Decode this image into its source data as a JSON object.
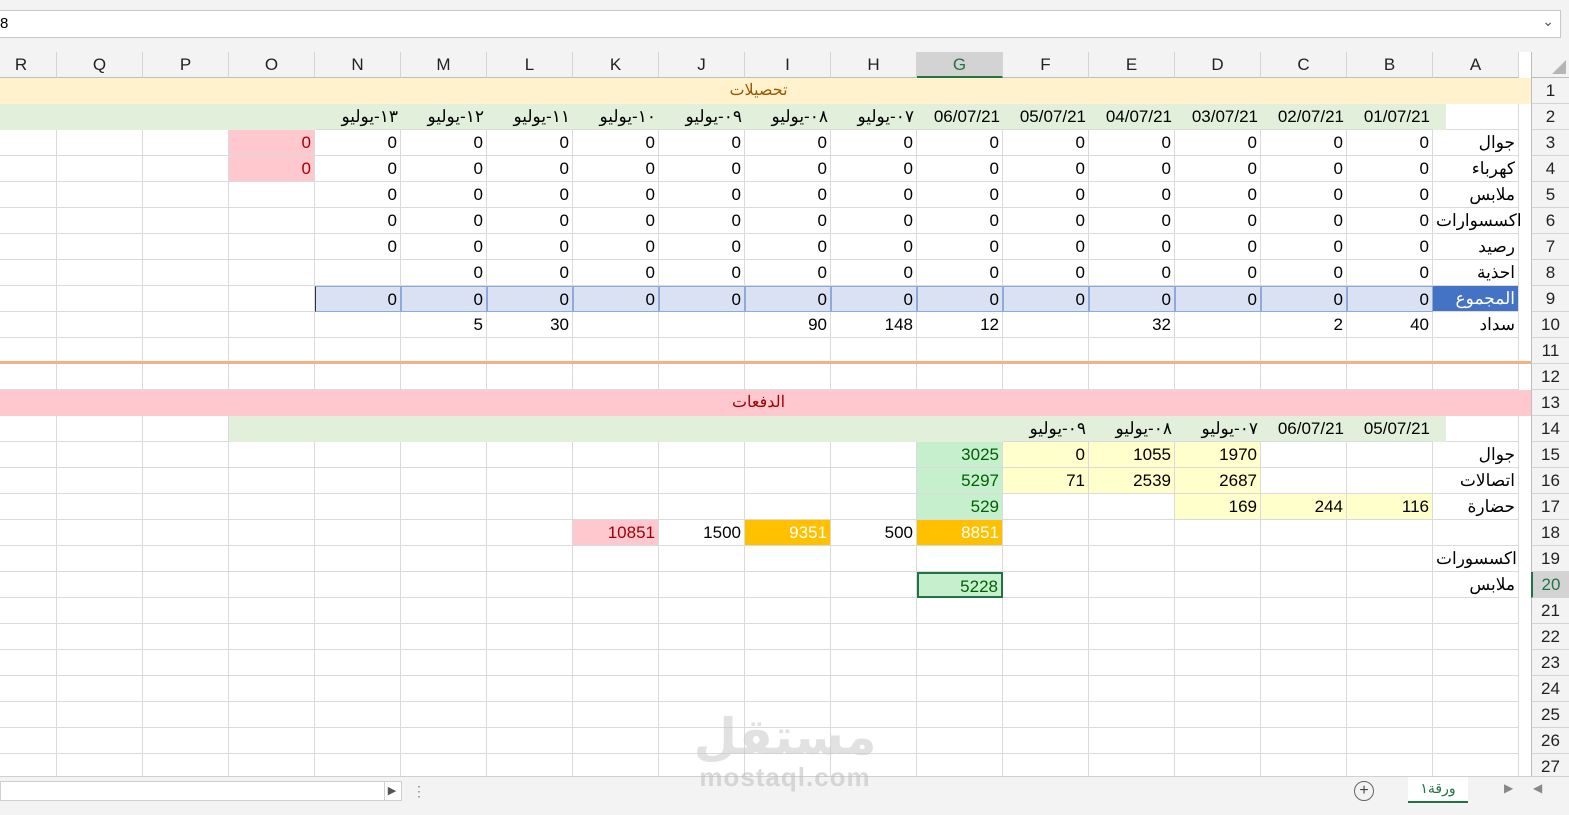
{
  "formula_bar": {
    "value": "8"
  },
  "columns": [
    "R",
    "Q",
    "P",
    "O",
    "N",
    "M",
    "L",
    "K",
    "J",
    "I",
    "H",
    "G",
    "F",
    "E",
    "D",
    "C",
    "B",
    "A"
  ],
  "selected_column": "G",
  "selected_row": 20,
  "rows": [
    1,
    2,
    3,
    4,
    5,
    6,
    7,
    8,
    9,
    10,
    11,
    12,
    13,
    14,
    15,
    16,
    17,
    18,
    19,
    20,
    21,
    22,
    23,
    24,
    25,
    26,
    27
  ],
  "section1": {
    "title": "تحصيلات",
    "dates": {
      "B": "01/07/21",
      "C": "02/07/21",
      "D": "03/07/21",
      "E": "04/07/21",
      "F": "05/07/21",
      "G": "06/07/21",
      "H": "٠٧-يوليو",
      "I": "٠٨-يوليو",
      "J": "٠٩-يوليو",
      "K": "١٠-يوليو",
      "L": "١١-يوليو",
      "M": "١٢-يوليو",
      "N": "١٣-يوليو"
    },
    "row_labels": {
      "3": "جوال",
      "4": "كهرباء",
      "5": "ملابس",
      "6": "اكسسوارات",
      "7": "رصيد",
      "8": "احذية",
      "9": "المجموع",
      "10": "سداد"
    },
    "zero_value": "0",
    "o_cells": {
      "3": "0",
      "4": "0"
    },
    "payments_row": {
      "B": "40",
      "C": "2",
      "E": "32",
      "G": "12",
      "H": "148",
      "I": "90",
      "L": "30",
      "M": "5"
    }
  },
  "section2": {
    "title": "الدفعات",
    "dates": {
      "B": "05/07/21",
      "C": "06/07/21",
      "D": "٠٧-يوليو",
      "E": "٠٨-يوليو",
      "F": "٠٩-يوليو"
    },
    "row_labels": {
      "15": "جوال",
      "16": "اتصالات",
      "17": "حضارة",
      "19": "اكسسورات",
      "20": "ملابس"
    },
    "values": {
      "15": {
        "D": "1970",
        "E": "1055",
        "F": "0",
        "G": "3025"
      },
      "16": {
        "D": "2687",
        "E": "2539",
        "F": "71",
        "G": "5297"
      },
      "17": {
        "B": "116",
        "C": "244",
        "D": "169",
        "G": "529"
      },
      "18": {
        "G": "8851",
        "H": "500",
        "I": "9351",
        "J": "1500",
        "K": "10851"
      },
      "20": {
        "G": "5228"
      }
    }
  },
  "sheet_tab": {
    "label": "ورقة١"
  },
  "add_sheet_symbol": "+",
  "watermark": {
    "brand": "مستقل",
    "url": "mostaql.com"
  },
  "colors": {
    "header_yellow": "#fff2cc",
    "date_green": "#e2efda",
    "pink": "#ffc7ce",
    "total_blue": "#d9e1f2",
    "orange": "#ffc000",
    "yellow_cell": "#ffffcc",
    "green_cell": "#c6efce",
    "accent": "#217346"
  }
}
